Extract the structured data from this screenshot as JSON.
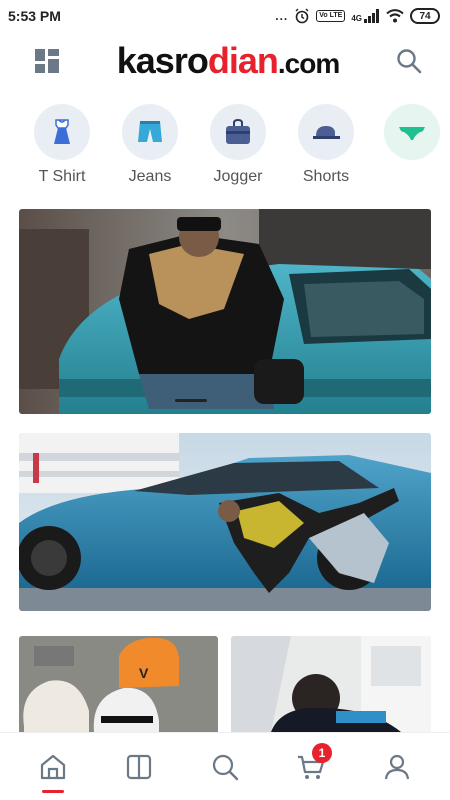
{
  "status_bar": {
    "time": "5:53 PM",
    "more": "...",
    "volte": "Vo LTE",
    "network": "4G",
    "battery": "74"
  },
  "header": {
    "logo_part1": "kasro",
    "logo_part2": "dian",
    "logo_part3": ".com",
    "menu_icon": "grid-menu-icon",
    "search_icon": "search-icon"
  },
  "categories": [
    {
      "label": "T Shirt",
      "icon": "tshirt-icon"
    },
    {
      "label": "Jeans",
      "icon": "jeans-icon"
    },
    {
      "label": "Jogger",
      "icon": "jogger-icon"
    },
    {
      "label": "Shorts",
      "icon": "shorts-icon"
    },
    {
      "label": "",
      "icon": "underwear-icon"
    }
  ],
  "colors": {
    "accent": "#e8222c",
    "category_bg": "#e9eef4",
    "icon_gray": "#6b7886"
  },
  "bottom_nav": {
    "items": [
      "home-icon",
      "catalog-icon",
      "search-icon",
      "cart-icon",
      "profile-icon"
    ],
    "cart_count": "1"
  }
}
